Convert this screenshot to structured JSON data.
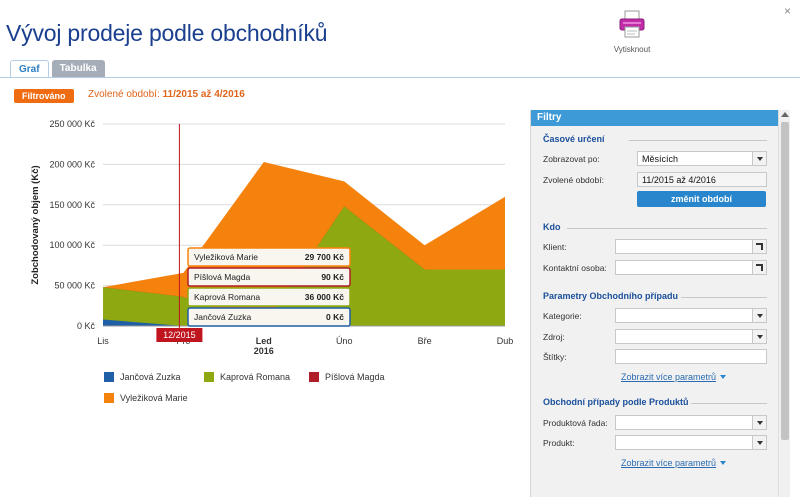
{
  "page": {
    "title": "Vývoj prodeje podle obchodníků",
    "close_glyph": "×"
  },
  "toolbar": {
    "print_label": "Vytisknout",
    "print_icon": "printer-icon"
  },
  "tabs": [
    {
      "label": "Graf",
      "active": true
    },
    {
      "label": "Tabulka",
      "active": false
    }
  ],
  "filter_status": {
    "badge": "Filtrováno",
    "period_prefix": "Zvolené období:",
    "period_value": "11/2015 až 4/2016"
  },
  "chart_data": {
    "type": "area",
    "stacked": true,
    "ylabel": "Zobchodovaný objem (Kč)",
    "ylim": [
      0,
      250000
    ],
    "yticks": [
      "0 Kč",
      "50 000 Kč",
      "100 000 Kč",
      "150 000 Kč",
      "200 000 Kč",
      "250 000 Kč"
    ],
    "categories": [
      "Lis",
      "Pro",
      "Led",
      "Úno",
      "Bře",
      "Dub"
    ],
    "year_label": "2016",
    "grid": true,
    "legend_position": "bottom",
    "series": [
      {
        "name": "Jančová Zuzka",
        "color": "#1f5fa6",
        "values": [
          8000,
          0,
          0,
          0,
          0,
          0
        ]
      },
      {
        "name": "Kaprová Romana",
        "color": "#8ea812",
        "values": [
          40000,
          36000,
          0,
          148000,
          70000,
          70000
        ]
      },
      {
        "name": "Píšlová Magda",
        "color": "#b01e2a",
        "values": [
          0,
          90,
          0,
          0,
          0,
          0
        ]
      },
      {
        "name": "Vyležiková Marie",
        "color": "#f5820d",
        "values": [
          0,
          29700,
          203000,
          31000,
          30000,
          90000
        ]
      }
    ],
    "crosshair": {
      "category_index": 1,
      "label": "12/2015"
    },
    "tooltip": [
      {
        "name": "Vyležiková Marie",
        "value": "29 700 Kč",
        "color": "#f5820d"
      },
      {
        "name": "Píšlová Magda",
        "value": "90 Kč",
        "color": "#b01e2a"
      },
      {
        "name": "Kaprová Romana",
        "value": "36 000 Kč",
        "color": "#8ea812"
      },
      {
        "name": "Jančová Zuzka",
        "value": "0 Kč",
        "color": "#1f5fa6"
      }
    ],
    "legend": [
      {
        "name": "Jančová Zuzka",
        "color": "#1f5fa6"
      },
      {
        "name": "Kaprová Romana",
        "color": "#8ea812"
      },
      {
        "name": "Píšlová Magda",
        "color": "#b01e2a"
      },
      {
        "name": "Vyležiková Marie",
        "color": "#f5820d"
      }
    ]
  },
  "filters": {
    "header": "Filtry",
    "time": {
      "title": "Časové určení",
      "display_by_label": "Zobrazovat po:",
      "display_by_value": "Měsících",
      "period_label": "Zvolené období:",
      "period_value": "11/2015 až 4/2016",
      "change_button": "změnit období"
    },
    "who": {
      "title": "Kdo",
      "client_label": "Klient:",
      "client_value": "",
      "contact_label": "Kontaktní osoba:",
      "contact_value": ""
    },
    "params": {
      "title": "Parametry Obchodního případu",
      "category_label": "Kategorie:",
      "source_label": "Zdroj:",
      "tags_label": "Štítky:",
      "more_link": "Zobrazit více parametrů"
    },
    "products": {
      "title": "Obchodní případy podle Produktů",
      "line_label": "Produktová řada:",
      "product_label": "Produkt:",
      "more_link": "Zobrazit více parametrů"
    }
  }
}
